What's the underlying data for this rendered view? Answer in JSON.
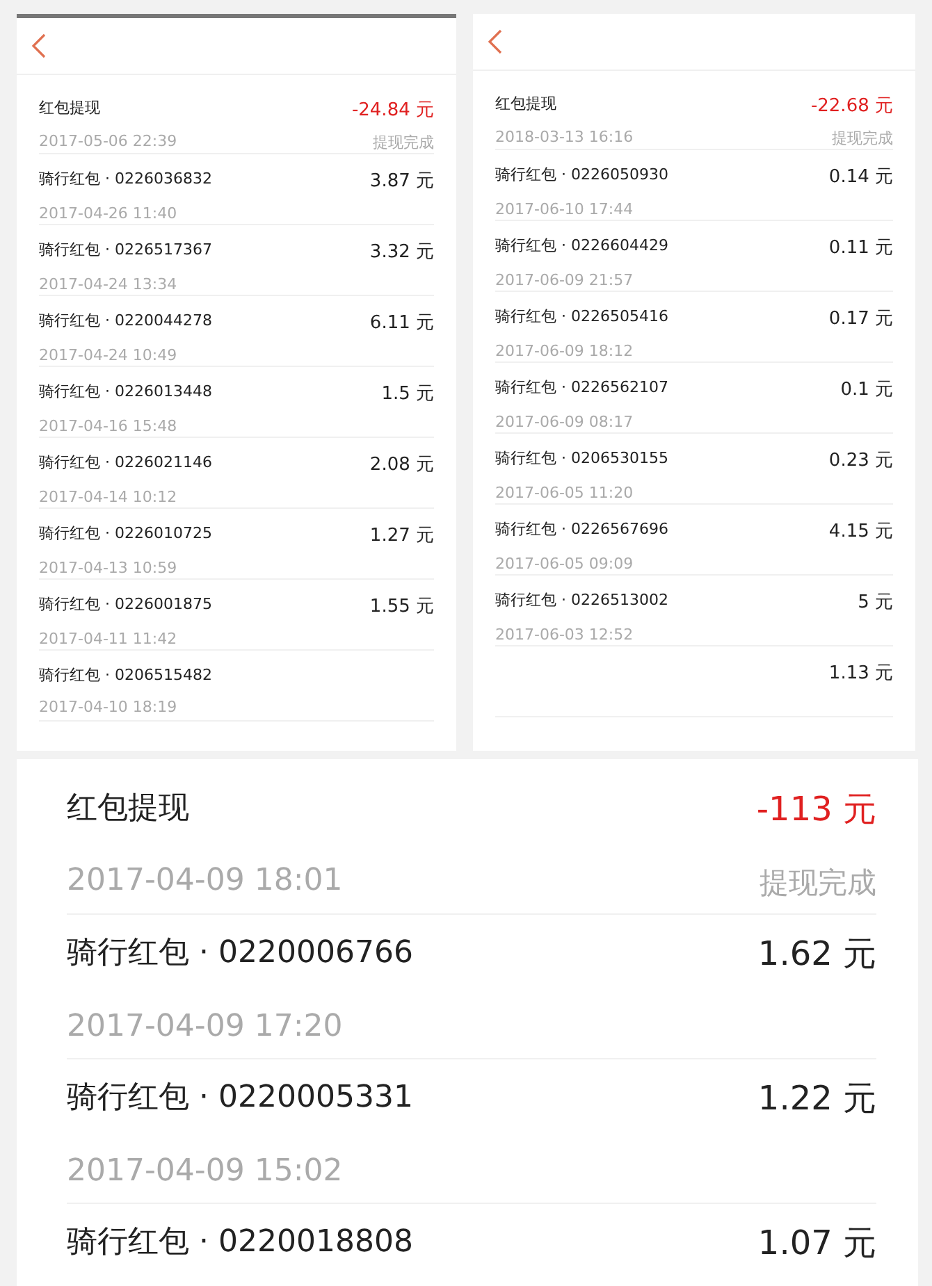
{
  "panels": [
    {
      "kind": "compact",
      "rows": [
        {
          "kind": "withdrawal",
          "title": "红包提现",
          "time": "2017-05-06 22:39",
          "amount": "-24.84 元",
          "status": "提现完成"
        },
        {
          "kind": "ride",
          "title": "骑行红包 · 0226036832",
          "time": "2017-04-26 11:40",
          "amount": "3.87 元"
        },
        {
          "kind": "ride",
          "title": "骑行红包 · 0226517367",
          "time": "2017-04-24 13:34",
          "amount": "3.32 元"
        },
        {
          "kind": "ride",
          "title": "骑行红包 · 0220044278",
          "time": "2017-04-24 10:49",
          "amount": "6.11 元"
        },
        {
          "kind": "ride",
          "title": "骑行红包 · 0226013448",
          "time": "2017-04-16 15:48",
          "amount": "1.5 元"
        },
        {
          "kind": "ride",
          "title": "骑行红包 · 0226021146",
          "time": "2017-04-14 10:12",
          "amount": "2.08 元"
        },
        {
          "kind": "ride",
          "title": "骑行红包 · 0226010725",
          "time": "2017-04-13 10:59",
          "amount": "1.27 元"
        },
        {
          "kind": "ride",
          "title": "骑行红包 · 0226001875",
          "time": "2017-04-11 11:42",
          "amount": "1.55 元"
        },
        {
          "kind": "ride",
          "title": "骑行红包 · 0206515482",
          "time": "2017-04-10 18:19"
        }
      ]
    },
    {
      "kind": "compact",
      "rows": [
        {
          "kind": "withdrawal",
          "title": "红包提现",
          "time": "2018-03-13 16:16",
          "amount": "-22.68 元",
          "status": "提现完成"
        },
        {
          "kind": "ride",
          "title": "骑行红包 · 0226050930",
          "time": "2017-06-10 17:44",
          "amount": "0.14 元"
        },
        {
          "kind": "ride",
          "title": "骑行红包 · 0226604429",
          "time": "2017-06-09 21:57",
          "amount": "0.11 元"
        },
        {
          "kind": "ride",
          "title": "骑行红包 · 0226505416",
          "time": "2017-06-09 18:12",
          "amount": "0.17 元"
        },
        {
          "kind": "ride",
          "title": "骑行红包 · 0226562107",
          "time": "2017-06-09 08:17",
          "amount": "0.1 元"
        },
        {
          "kind": "ride",
          "title": "骑行红包 · 0206530155",
          "time": "2017-06-05 11:20",
          "amount": "0.23 元"
        },
        {
          "kind": "ride",
          "title": "骑行红包 · 0226567696",
          "time": "2017-06-05 09:09",
          "amount": "4.15 元"
        },
        {
          "kind": "ride",
          "title": "骑行红包 · 0226513002",
          "time": "2017-06-03 12:52",
          "amount": "5 元"
        },
        {
          "kind": "ride",
          "amount": "1.13 元"
        }
      ]
    },
    {
      "kind": "large",
      "rows": [
        {
          "kind": "withdrawal",
          "title": "红包提现",
          "time": "2017-04-09 18:01",
          "amount": "-113 元",
          "status": "提现完成"
        },
        {
          "kind": "ride",
          "title": "骑行红包 · 0220006766",
          "time": "2017-04-09 17:20",
          "amount": "1.62 元"
        },
        {
          "kind": "ride",
          "title": "骑行红包 · 0220005331",
          "time": "2017-04-09 15:02",
          "amount": "1.22 元"
        },
        {
          "kind": "ride",
          "title": "骑行红包 · 0220018808",
          "amount": "1.07 元"
        }
      ]
    }
  ]
}
